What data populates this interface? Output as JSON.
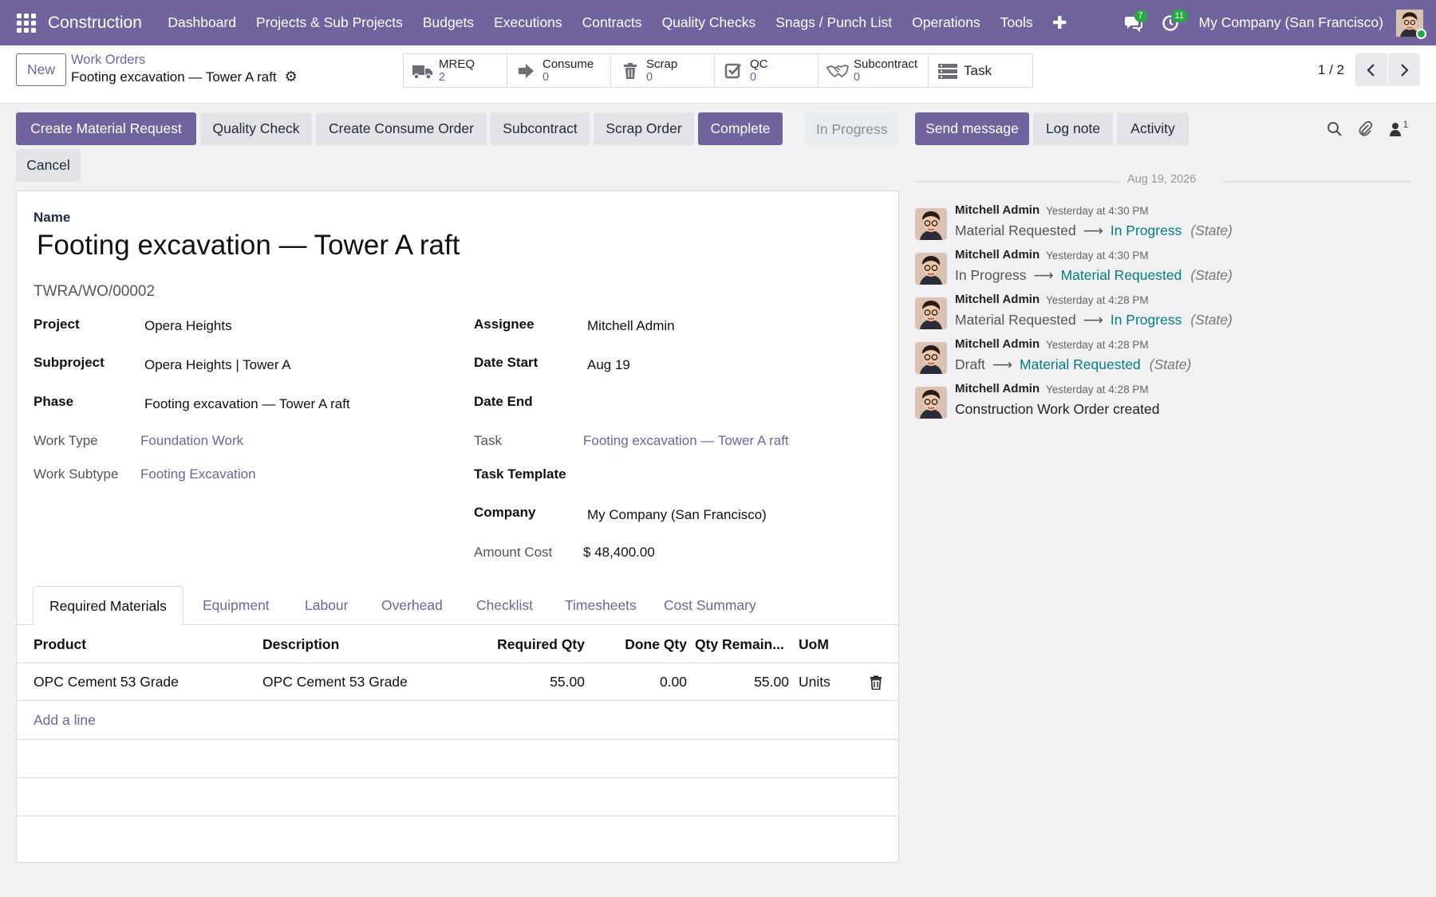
{
  "navbar": {
    "brand": "Construction",
    "menu": [
      "Dashboard",
      "Projects & Sub Projects",
      "Budgets",
      "Executions",
      "Contracts",
      "Quality Checks",
      "Snags / Punch List",
      "Operations",
      "Tools"
    ],
    "messages_badge": "7",
    "activity_badge": "11",
    "company": "My Company (San Francisco)",
    "accent": "#71639e"
  },
  "control": {
    "new_label": "New",
    "breadcrumb_parent": "Work Orders",
    "breadcrumb_current": "Footing excavation — Tower A raft",
    "pager_value": "1 / 2",
    "smart_buttons": [
      {
        "label": "MREQ",
        "count": "2",
        "icon": "truck-icon"
      },
      {
        "label": "Consume",
        "count": "0",
        "icon": "sign-in-icon"
      },
      {
        "label": "Scrap",
        "count": "0",
        "icon": "trash-icon"
      },
      {
        "label": "QC",
        "count": "0",
        "icon": "check-square-icon"
      },
      {
        "label": "Subcontract",
        "count": "0",
        "icon": "handshake-icon"
      },
      {
        "label": "Task",
        "icon": "tasks-icon"
      }
    ]
  },
  "actions": {
    "create_material_request": "Create Material Request",
    "quality_check": "Quality Check",
    "create_consume_order": "Create Consume Order",
    "subcontract": "Subcontract",
    "scrap_order": "Scrap Order",
    "complete": "Complete",
    "cancel": "Cancel",
    "state": "In Progress"
  },
  "chatter": {
    "send_message": "Send message",
    "log_note": "Log note",
    "activity": "Activity",
    "followers_count": "1",
    "date": "Aug 19, 2026",
    "messages": [
      {
        "author": "Mitchell Admin",
        "time": "Yesterday at 4:30 PM",
        "old": "Material Requested",
        "new": "In Progress",
        "field": "(State)"
      },
      {
        "author": "Mitchell Admin",
        "time": "Yesterday at 4:30 PM",
        "old": "In Progress",
        "new": "Material Requested",
        "field": "(State)"
      },
      {
        "author": "Mitchell Admin",
        "time": "Yesterday at 4:28 PM",
        "old": "Material Requested",
        "new": "In Progress",
        "field": "(State)"
      },
      {
        "author": "Mitchell Admin",
        "time": "Yesterday at 4:28 PM",
        "old": "Draft",
        "new": "Material Requested",
        "field": "(State)"
      },
      {
        "author": "Mitchell Admin",
        "time": "Yesterday at 4:28 PM",
        "text": "Construction Work Order created"
      }
    ]
  },
  "form": {
    "name_label": "Name",
    "name": "Footing excavation — Tower A raft",
    "reference": "TWRA/WO/00002",
    "project_label": "Project",
    "project": "Opera Heights",
    "subproject_label": "Subproject",
    "subproject": "Opera Heights | Tower A",
    "phase_label": "Phase",
    "phase": "Footing excavation — Tower A raft",
    "work_type_label": "Work Type",
    "work_type": "Foundation Work",
    "work_subtype_label": "Work Subtype",
    "work_subtype": "Footing Excavation",
    "assignee_label": "Assignee",
    "assignee": "Mitchell Admin",
    "date_start_label": "Date Start",
    "date_start": "Aug 19",
    "date_end_label": "Date End",
    "date_end": "",
    "task_label": "Task",
    "task": "Footing excavation — Tower A raft",
    "task_template_label": "Task Template",
    "task_template": "",
    "company_label": "Company",
    "company": "My Company (San Francisco)",
    "amount_cost_label": "Amount Cost",
    "amount_cost": "$ 48,400.00"
  },
  "tabs": [
    "Required Materials",
    "Equipment",
    "Labour",
    "Overhead",
    "Checklist",
    "Timesheets",
    "Cost Summary"
  ],
  "materials": {
    "columns": [
      "Product",
      "Description",
      "Required Qty",
      "Done Qty",
      "Qty Remain...",
      "UoM"
    ],
    "rows": [
      {
        "product": "OPC Cement 53 Grade",
        "description": "OPC Cement 53 Grade",
        "required_qty": "55.00",
        "done_qty": "0.00",
        "qty_remaining": "55.00",
        "uom": "Units"
      }
    ],
    "add_line": "Add a line"
  }
}
